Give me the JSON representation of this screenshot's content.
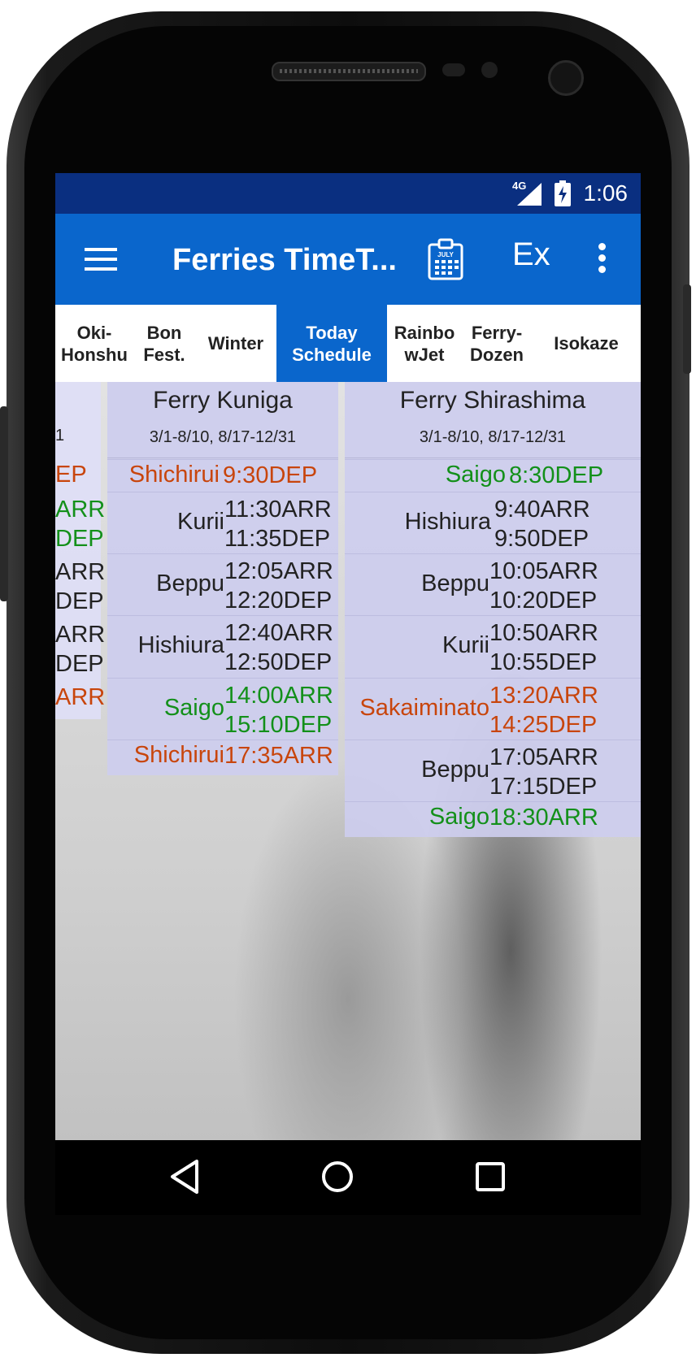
{
  "status": {
    "network": "4G",
    "time": "1:06"
  },
  "appbar": {
    "title": "Ferries TimeT...",
    "ex_label": "Ex",
    "calendar_label": "JULY"
  },
  "tabs": [
    {
      "label": "Oki-\nHonshu"
    },
    {
      "label": "Bon\nFest."
    },
    {
      "label": "Winter"
    },
    {
      "label": "Today\nSchedule",
      "active": true
    },
    {
      "label": "Rainbo\nwJet"
    },
    {
      "label": "Ferry-\nDozen"
    },
    {
      "label": "Isokaze"
    }
  ],
  "partial_column": {
    "period": "1",
    "times": [
      "EP",
      "ARR",
      "DEP",
      "ARR",
      "DEP",
      "ARR",
      "DEP",
      "ARR"
    ]
  },
  "kuniga": {
    "name": "Ferry Kuniga",
    "period": "3/1-8/10, 8/17-12/31",
    "rows": [
      {
        "stop": "Shichirui",
        "t1": "9:30DEP",
        "t2": ""
      },
      {
        "stop": "Kurii",
        "t1": "11:30ARR",
        "t2": "11:35DEP"
      },
      {
        "stop": "Beppu",
        "t1": "12:05ARR",
        "t2": "12:20DEP"
      },
      {
        "stop": "Hishiura",
        "t1": "12:40ARR",
        "t2": "12:50DEP"
      },
      {
        "stop": "Saigo",
        "t1": "14:00ARR",
        "t2": "15:10DEP"
      },
      {
        "stop": "Shichirui",
        "t1": "17:35ARR",
        "t2": ""
      }
    ]
  },
  "shirashima": {
    "name": "Ferry Shirashima",
    "period": "3/1-8/10, 8/17-12/31",
    "rows": [
      {
        "stop": "Saigo",
        "t1": "8:30DEP",
        "t2": ""
      },
      {
        "stop": "Hishiura",
        "t1": "9:40ARR",
        "t2": "9:50DEP"
      },
      {
        "stop": "Beppu",
        "t1": "10:05ARR",
        "t2": "10:20DEP"
      },
      {
        "stop": "Kurii",
        "t1": "10:50ARR",
        "t2": "10:55DEP"
      },
      {
        "stop": "Sakaiminato",
        "t1": "13:20ARR",
        "t2": "14:25DEP"
      },
      {
        "stop": "Beppu",
        "t1": "17:05ARR",
        "t2": "17:15DEP"
      },
      {
        "stop": "Saigo",
        "t1": "18:30ARR",
        "t2": ""
      }
    ]
  },
  "colors": {
    "statusbar": "#0a2f80",
    "appbar": "#0a66cc",
    "depart_red": "#c8450c",
    "arrive_green": "#13901a",
    "column_bg": "#cdcdee"
  }
}
